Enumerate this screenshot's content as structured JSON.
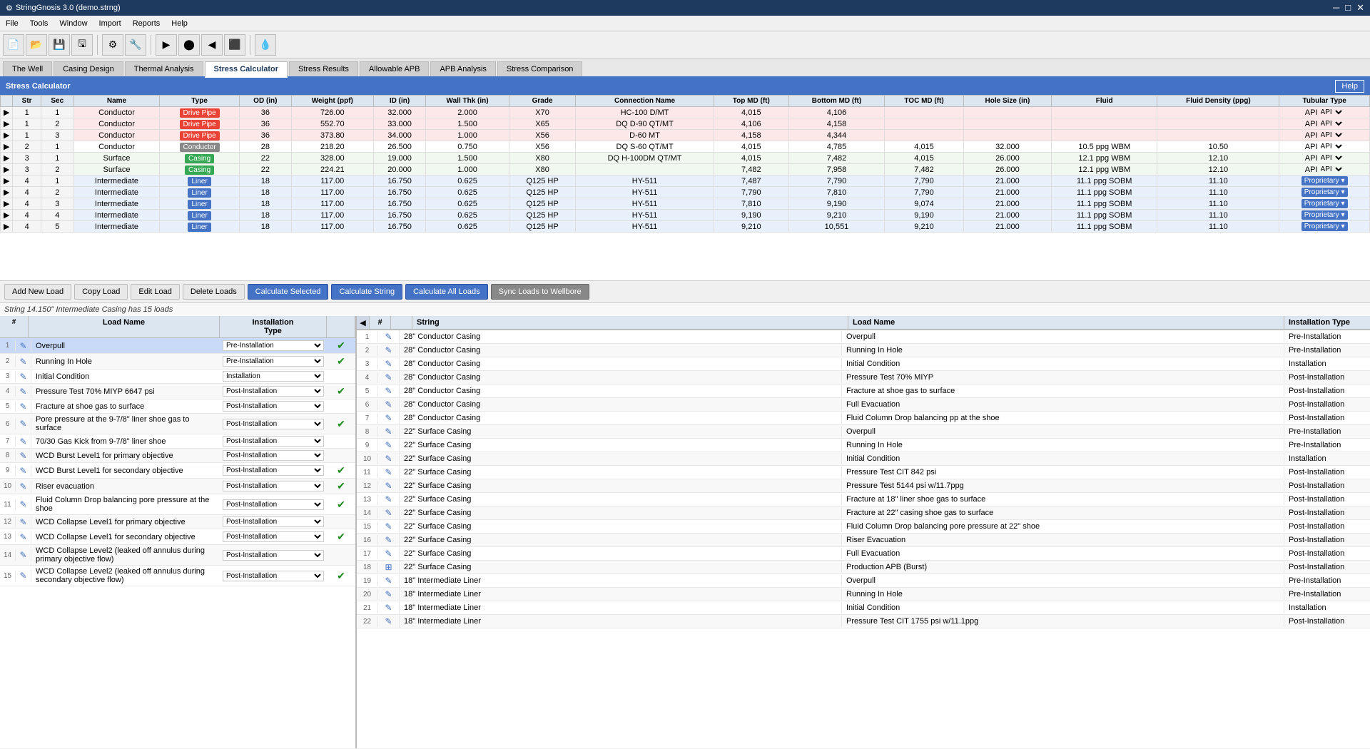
{
  "window": {
    "title": "StringGnosis 3.0 (demo.strng)"
  },
  "menu": {
    "items": [
      "File",
      "Tools",
      "Window",
      "Import",
      "Reports",
      "Help"
    ]
  },
  "tabs": [
    {
      "label": "The Well",
      "active": false
    },
    {
      "label": "Casing Design",
      "active": false
    },
    {
      "label": "Thermal Analysis",
      "active": false
    },
    {
      "label": "Stress Calculator",
      "active": true
    },
    {
      "label": "Stress Results",
      "active": false
    },
    {
      "label": "Allowable APB",
      "active": false
    },
    {
      "label": "APB Analysis",
      "active": false
    },
    {
      "label": "Stress Comparison",
      "active": false
    }
  ],
  "sc_header": "Stress Calculator",
  "help_btn": "Help",
  "table_headers": {
    "str": "Str",
    "sec": "Sec",
    "name": "Name",
    "type": "Type",
    "od_in": "OD (in)",
    "weight_ppf": "Weight (ppf)",
    "id_in": "ID (in)",
    "wall_thk_in": "Wall Thk (in)",
    "grade": "Grade",
    "connection_name": "Connection Name",
    "top_md_ft": "Top MD (ft)",
    "bottom_md_ft": "Bottom MD (ft)",
    "toc_md_ft": "TOC MD (ft)",
    "hole_size_in": "Hole Size (in)",
    "fluid": "Fluid",
    "fluid_density_ppg": "Fluid Density (ppg)",
    "tubular_type": "Tubular Type"
  },
  "table_rows": [
    {
      "str": 1,
      "sec": 1,
      "name": "Conductor",
      "type": "Drive Pipe",
      "type_class": "dp",
      "od": "36",
      "weight": "726.00",
      "id": "32.000",
      "wall": "2.000",
      "grade": "X70",
      "connection": "HC-100 D/MT",
      "top_md": "4,015",
      "bottom_md": "4,106",
      "toc_md": "",
      "hole_size": "",
      "fluid": "",
      "fluid_density": "",
      "tubular": "API"
    },
    {
      "str": 1,
      "sec": 2,
      "name": "Conductor",
      "type": "Drive Pipe",
      "type_class": "dp",
      "od": "36",
      "weight": "552.70",
      "id": "33.000",
      "wall": "1.500",
      "grade": "X65",
      "connection": "DQ D-90 QT/MT",
      "top_md": "4,106",
      "bottom_md": "4,158",
      "toc_md": "",
      "hole_size": "",
      "fluid": "",
      "fluid_density": "",
      "tubular": "API"
    },
    {
      "str": 1,
      "sec": 3,
      "name": "Conductor",
      "type": "Drive Pipe",
      "type_class": "dp",
      "od": "36",
      "weight": "373.80",
      "id": "34.000",
      "wall": "1.000",
      "grade": "X56",
      "connection": "D-60 MT",
      "top_md": "4,158",
      "bottom_md": "4,344",
      "toc_md": "",
      "hole_size": "",
      "fluid": "",
      "fluid_density": "",
      "tubular": "API"
    },
    {
      "str": 2,
      "sec": 1,
      "name": "Conductor",
      "type": "Conductor",
      "type_class": "",
      "od": "28",
      "weight": "218.20",
      "id": "26.500",
      "wall": "0.750",
      "grade": "X56",
      "connection": "DQ S-60 QT/MT",
      "top_md": "4,015",
      "bottom_md": "4,785",
      "toc_md": "4,015",
      "hole_size": "32.000",
      "fluid": "10.5 ppg WBM",
      "fluid_density": "10.50",
      "tubular": "API"
    },
    {
      "str": 3,
      "sec": 1,
      "name": "Surface",
      "type": "Casing",
      "type_class": "casing",
      "od": "22",
      "weight": "328.00",
      "id": "19.000",
      "wall": "1.500",
      "grade": "X80",
      "connection": "DQ H-100DM QT/MT",
      "top_md": "4,015",
      "bottom_md": "7,482",
      "toc_md": "4,015",
      "hole_size": "26.000",
      "fluid": "12.1 ppg WBM",
      "fluid_density": "12.10",
      "tubular": "API"
    },
    {
      "str": 3,
      "sec": 2,
      "name": "Surface",
      "type": "Casing",
      "type_class": "casing",
      "od": "22",
      "weight": "224.21",
      "id": "20.000",
      "wall": "1.000",
      "grade": "X80",
      "connection": "",
      "top_md": "7,482",
      "bottom_md": "7,958",
      "toc_md": "7,482",
      "hole_size": "26.000",
      "fluid": "12.1 ppg WBM",
      "fluid_density": "12.10",
      "tubular": "API"
    },
    {
      "str": 4,
      "sec": 1,
      "name": "Intermediate",
      "type": "Liner",
      "type_class": "liner",
      "od": "18",
      "weight": "117.00",
      "id": "16.750",
      "wall": "0.625",
      "grade": "Q125 HP",
      "connection": "HY-511",
      "top_md": "7,487",
      "bottom_md": "7,790",
      "toc_md": "7,790",
      "hole_size": "21.000",
      "fluid": "11.1 ppg SOBM",
      "fluid_density": "11.10",
      "tubular": "Proprietary"
    },
    {
      "str": 4,
      "sec": 2,
      "name": "Intermediate",
      "type": "Liner",
      "type_class": "liner",
      "od": "18",
      "weight": "117.00",
      "id": "16.750",
      "wall": "0.625",
      "grade": "Q125 HP",
      "connection": "HY-511",
      "top_md": "7,790",
      "bottom_md": "7,810",
      "toc_md": "7,790",
      "hole_size": "21.000",
      "fluid": "11.1 ppg SOBM",
      "fluid_density": "11.10",
      "tubular": "Proprietary"
    },
    {
      "str": 4,
      "sec": 3,
      "name": "Intermediate",
      "type": "Liner",
      "type_class": "liner",
      "od": "18",
      "weight": "117.00",
      "id": "16.750",
      "wall": "0.625",
      "grade": "Q125 HP",
      "connection": "HY-511",
      "top_md": "7,810",
      "bottom_md": "9,190",
      "toc_md": "9,074",
      "hole_size": "21.000",
      "fluid": "11.1 ppg SOBM",
      "fluid_density": "11.10",
      "tubular": "Proprietary"
    },
    {
      "str": 4,
      "sec": 4,
      "name": "Intermediate",
      "type": "Liner",
      "type_class": "liner",
      "od": "18",
      "weight": "117.00",
      "id": "16.750",
      "wall": "0.625",
      "grade": "Q125 HP",
      "connection": "HY-511",
      "top_md": "9,190",
      "bottom_md": "9,210",
      "toc_md": "9,190",
      "hole_size": "21.000",
      "fluid": "11.1 ppg SOBM",
      "fluid_density": "11.10",
      "tubular": "Proprietary"
    },
    {
      "str": 4,
      "sec": 5,
      "name": "Intermediate",
      "type": "Liner",
      "type_class": "liner",
      "od": "18",
      "weight": "117.00",
      "id": "16.750",
      "wall": "0.625",
      "grade": "Q125 HP",
      "connection": "HY-511",
      "top_md": "9,210",
      "bottom_md": "10,551",
      "toc_md": "9,210",
      "hole_size": "21.000",
      "fluid": "11.1 ppg SOBM",
      "fluid_density": "11.10",
      "tubular": "Proprietary"
    }
  ],
  "buttons": {
    "add_new_load": "Add New Load",
    "copy_load": "Copy Load",
    "edit_load": "Edit Load",
    "delete_loads": "Delete Loads",
    "calculate_selected": "Calculate Selected",
    "calculate_string": "Calculate String",
    "calculate_all_loads": "Calculate All Loads",
    "sync_loads_to_wellbore": "Sync Loads to Wellbore"
  },
  "info_text": "String 14.150\" Intermediate Casing has 15 loads",
  "left_panel": {
    "headers": {
      "num": "#",
      "edit": "",
      "load_name": "Load Name",
      "installation_type": "Installation Type",
      "check": ""
    },
    "rows": [
      {
        "num": 1,
        "name": "Overpull",
        "inst_type": "Pre-Installation",
        "checked": true,
        "selected": true
      },
      {
        "num": 2,
        "name": "Running In Hole",
        "inst_type": "Pre-Installation",
        "checked": true
      },
      {
        "num": 3,
        "name": "Initial Condition",
        "inst_type": "Installation",
        "checked": false
      },
      {
        "num": 4,
        "name": "Pressure Test 70% MIYP 6647 psi",
        "inst_type": "Post-Installation",
        "checked": true
      },
      {
        "num": 5,
        "name": "Fracture at shoe gas to surface",
        "inst_type": "Post-Installation",
        "checked": false
      },
      {
        "num": 6,
        "name": "Pore pressure at the 9-7/8\" liner shoe gas to surface",
        "inst_type": "Post-Installation",
        "checked": true
      },
      {
        "num": 7,
        "name": "70/30 Gas Kick from 9-7/8\" liner shoe",
        "inst_type": "Post-Installation",
        "checked": false
      },
      {
        "num": 8,
        "name": "WCD Burst Level1 for primary objective",
        "inst_type": "Post-Installation",
        "checked": false
      },
      {
        "num": 9,
        "name": "WCD Burst Level1 for secondary objective",
        "inst_type": "Post-Installation",
        "checked": true
      },
      {
        "num": 10,
        "name": "Riser evacuation",
        "inst_type": "Post-Installation",
        "checked": true
      },
      {
        "num": 11,
        "name": "Fluid Column Drop balancing pore pressure at the shoe",
        "inst_type": "Post-Installation",
        "checked": true
      },
      {
        "num": 12,
        "name": "WCD Collapse Level1 for primary objective",
        "inst_type": "Post-Installation",
        "checked": false
      },
      {
        "num": 13,
        "name": "WCD Collapse Level1 for secondary objective",
        "inst_type": "Post-Installation",
        "checked": true
      },
      {
        "num": 14,
        "name": "WCD Collapse Level2 (leaked off annulus during primary objective flow)",
        "inst_type": "Post-Installation",
        "checked": false
      },
      {
        "num": 15,
        "name": "WCD Collapse Level2 (leaked off annulus during secondary objective flow)",
        "inst_type": "Post-Installation",
        "checked": true
      }
    ]
  },
  "right_panel": {
    "headers": {
      "num": "#",
      "edit": "",
      "string": "String",
      "load_name": "Load Name",
      "installation_type": "Installation Type"
    },
    "rows": [
      {
        "num": 1,
        "string": "28\" Conductor Casing",
        "name": "Overpull",
        "type": "Pre-Installation"
      },
      {
        "num": 2,
        "string": "28\" Conductor Casing",
        "name": "Running In Hole",
        "type": "Pre-Installation"
      },
      {
        "num": 3,
        "string": "28\" Conductor Casing",
        "name": "Initial Condition",
        "type": "Installation"
      },
      {
        "num": 4,
        "string": "28\" Conductor Casing",
        "name": "Pressure Test 70% MIYP",
        "type": "Post-Installation"
      },
      {
        "num": 5,
        "string": "28\" Conductor Casing",
        "name": "Fracture at shoe gas to surface",
        "type": "Post-Installation"
      },
      {
        "num": 6,
        "string": "28\" Conductor Casing",
        "name": "Full Evacuation",
        "type": "Post-Installation"
      },
      {
        "num": 7,
        "string": "28\" Conductor Casing",
        "name": "Fluid Column Drop balancing pp at the shoe",
        "type": "Post-Installation"
      },
      {
        "num": 8,
        "string": "22\" Surface Casing",
        "name": "Overpull",
        "type": "Pre-Installation"
      },
      {
        "num": 9,
        "string": "22\" Surface Casing",
        "name": "Running In Hole",
        "type": "Pre-Installation"
      },
      {
        "num": 10,
        "string": "22\" Surface Casing",
        "name": "Initial Condition",
        "type": "Installation"
      },
      {
        "num": 11,
        "string": "22\" Surface Casing",
        "name": "Pressure Test CIT 842 psi",
        "type": "Post-Installation"
      },
      {
        "num": 12,
        "string": "22\" Surface Casing",
        "name": "Pressure Test 5144 psi w/11.7ppg",
        "type": "Post-Installation"
      },
      {
        "num": 13,
        "string": "22\" Surface Casing",
        "name": "Fracture at 18\" liner shoe gas to surface",
        "type": "Post-Installation"
      },
      {
        "num": 14,
        "string": "22\" Surface Casing",
        "name": "Fracture at 22\" casing shoe gas to surface",
        "type": "Post-Installation"
      },
      {
        "num": 15,
        "string": "22\" Surface Casing",
        "name": "Fluid Column Drop balancing pore pressure at 22\" shoe",
        "type": "Post-Installation"
      },
      {
        "num": 16,
        "string": "22\" Surface Casing",
        "name": "Riser Evacuation",
        "type": "Post-Installation"
      },
      {
        "num": 17,
        "string": "22\" Surface Casing",
        "name": "Full Evacuation",
        "type": "Post-Installation"
      },
      {
        "num": 18,
        "string": "22\" Surface Casing",
        "name": "Production APB (Burst)",
        "type": "Post-Installation",
        "special_icon": true
      },
      {
        "num": 19,
        "string": "18\" Intermediate Liner",
        "name": "Overpull",
        "type": "Pre-Installation"
      },
      {
        "num": 20,
        "string": "18\" Intermediate Liner",
        "name": "Running In Hole",
        "type": "Pre-Installation"
      },
      {
        "num": 21,
        "string": "18\" Intermediate Liner",
        "name": "Initial Condition",
        "type": "Installation"
      },
      {
        "num": 22,
        "string": "18\" Intermediate Liner",
        "name": "Pressure Test CIT 1755 psi w/11.1ppg",
        "type": "Post-Installation"
      }
    ]
  }
}
